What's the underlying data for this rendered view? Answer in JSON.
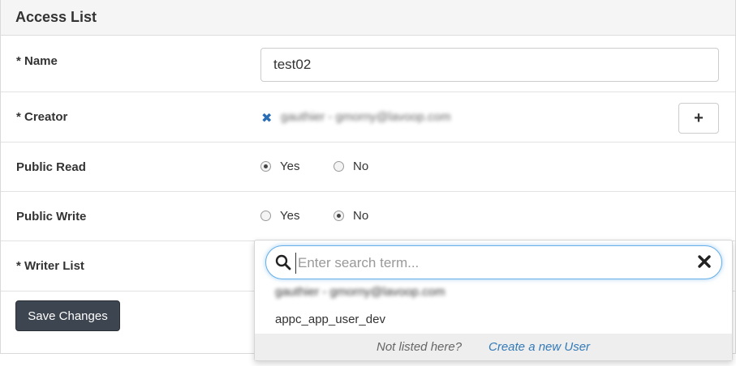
{
  "panel": {
    "title": "Access List"
  },
  "form": {
    "name": {
      "label": "* Name",
      "value": "test02"
    },
    "creator": {
      "label": "* Creator",
      "remove_glyph": "✖",
      "value_blurred": "gauthier - gmorny@lavoop.com",
      "add_glyph": "+"
    },
    "public_read": {
      "label": "Public Read",
      "options": [
        {
          "label": "Yes",
          "checked": true
        },
        {
          "label": "No",
          "checked": false
        }
      ]
    },
    "public_write": {
      "label": "Public Write",
      "options": [
        {
          "label": "Yes",
          "checked": false
        },
        {
          "label": "No",
          "checked": true
        }
      ]
    },
    "writer_list": {
      "label": "* Writer List"
    }
  },
  "save_button": {
    "label": "Save Changes"
  },
  "dropdown": {
    "search_placeholder": "Enter search term...",
    "options": [
      "gauthier - gmorny@lavoop.com",
      "appc_app_user_dev"
    ],
    "footer": {
      "prompt": "Not listed here?",
      "link": "Create a new User"
    }
  },
  "colors": {
    "accent_link": "#337ab7",
    "remove_x": "#2a6db5",
    "primary_button": "#3d4550",
    "focus_ring": "#66afe9"
  }
}
